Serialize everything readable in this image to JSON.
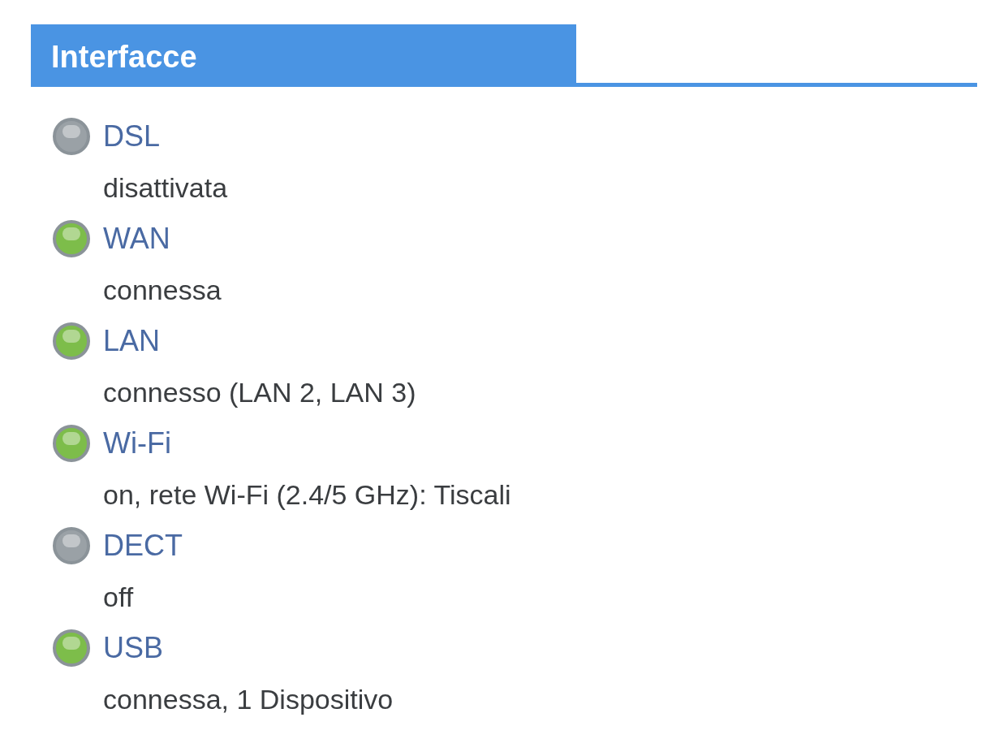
{
  "panel": {
    "title": "Interfacce"
  },
  "interfaces": [
    {
      "name": "DSL",
      "status": "disattivata",
      "color": "#9aa1a6"
    },
    {
      "name": "WAN",
      "status": "connessa",
      "color": "#7dbd4a"
    },
    {
      "name": "LAN",
      "status": "connesso (LAN 2, LAN 3)",
      "color": "#7dbd4a"
    },
    {
      "name": "Wi-Fi",
      "status": "on, rete Wi-Fi (2.4/5 GHz): Tiscali",
      "color": "#7dbd4a"
    },
    {
      "name": "DECT",
      "status": "off",
      "color": "#9aa1a6"
    },
    {
      "name": "USB",
      "status": "connessa, 1 Dispositivo",
      "color": "#7dbd4a"
    }
  ]
}
